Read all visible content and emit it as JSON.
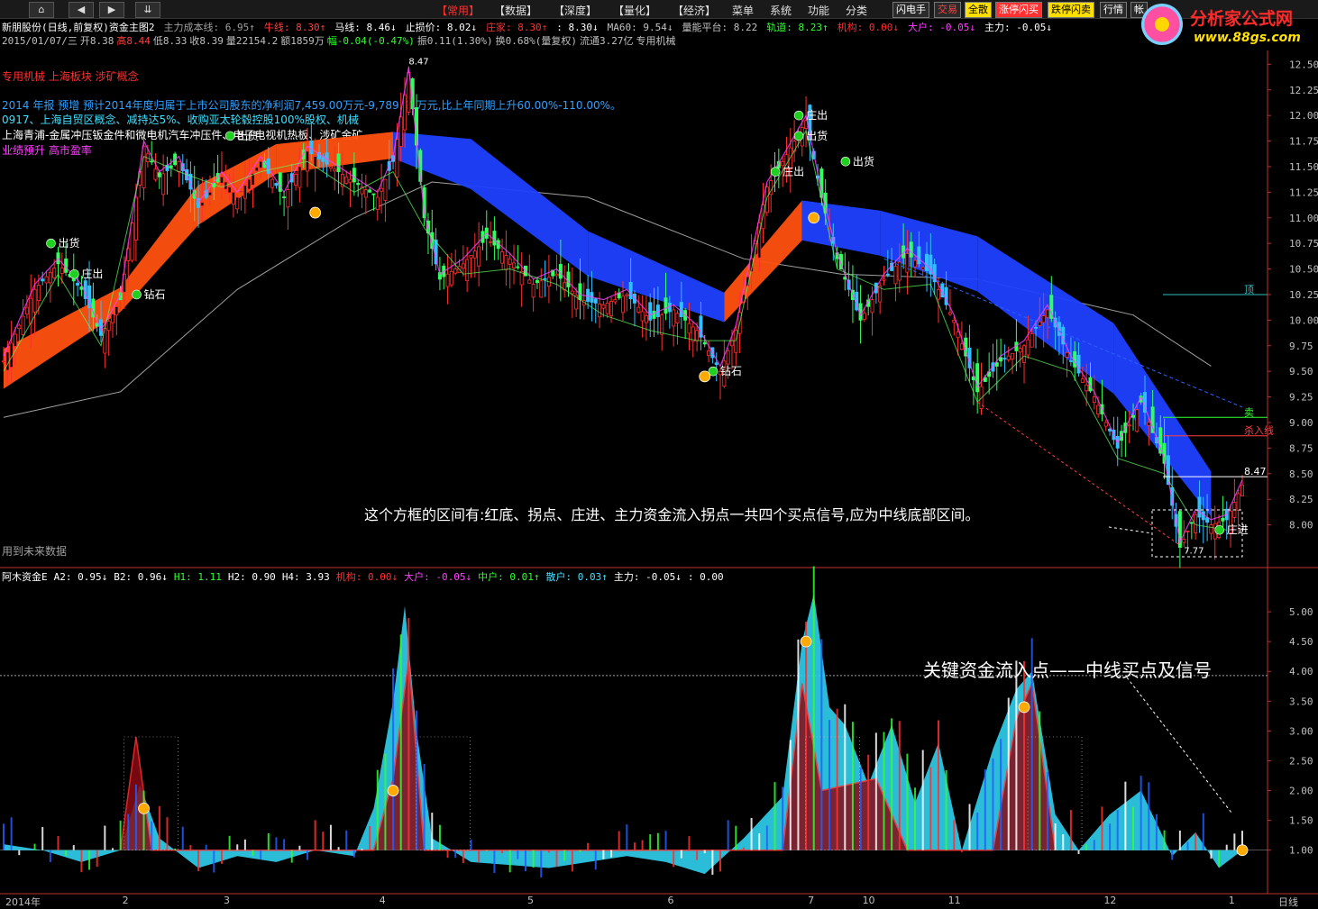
{
  "toolbar": {
    "nav": [
      "⌂",
      "◀",
      "▶",
      "⇊"
    ],
    "menus": [
      "【常用】",
      "【数据】",
      "【深度】",
      "【量化】",
      "【经济】",
      "菜单",
      "系统",
      "功能",
      "分类"
    ],
    "quick": [
      {
        "label": "闪电手",
        "bg": "#2a2a2a",
        "fg": "#ffffff"
      },
      {
        "label": "交易",
        "bg": "#2a2a2a",
        "fg": "#ff4040"
      },
      {
        "label": "全散",
        "bg": "#ffe000",
        "fg": "#000000"
      },
      {
        "label": "涨停闪买",
        "bg": "#ff3030",
        "fg": "#ffffff"
      },
      {
        "label": "跌停闪卖",
        "bg": "#ffe000",
        "fg": "#000000"
      },
      {
        "label": "行情",
        "bg": "#2a2a2a",
        "fg": "#ffffff"
      },
      {
        "label": "帐",
        "bg": "#2a2a2a",
        "fg": "#ffffff"
      }
    ]
  },
  "logo": {
    "title": "分析家公式网",
    "url": "www.88gs.com"
  },
  "header": {
    "line1": [
      {
        "text": "新朋股份(日线,前复权)资金主图2",
        "color": "#ffffff"
      },
      {
        "text": "主力成本线: 6.95↑",
        "color": "#a0a0a0"
      },
      {
        "text": "牛线: 8.30↑",
        "color": "#ff4040"
      },
      {
        "text": "马线: 8.46↓",
        "color": "#ffffff"
      },
      {
        "text": "止损价: 8.02↓",
        "color": "#ffffff"
      },
      {
        "text": "庄家: 8.30↑",
        "color": "#ff3030"
      },
      {
        "text": ": 8.30↓",
        "color": "#ffffff"
      },
      {
        "text": "MA60: 9.54↓",
        "color": "#c0c0c0"
      },
      {
        "text": "量能平台: 8.22",
        "color": "#c0c0c0"
      },
      {
        "text": "轨道: 8.23↑",
        "color": "#30ff30"
      },
      {
        "text": "机构: 0.00↓",
        "color": "#ff3030"
      },
      {
        "text": "大户: -0.05↓",
        "color": "#ff40ff"
      },
      {
        "text": "主力: -0.05↓",
        "color": "#ffffff"
      }
    ],
    "line2": [
      {
        "text": "2015/01/07/三",
        "color": "#c0c0c0"
      },
      {
        "text": "开8.38",
        "color": "#c0c0c0"
      },
      {
        "text": "高8.44",
        "color": "#ff4040"
      },
      {
        "text": "低8.33",
        "color": "#c0c0c0"
      },
      {
        "text": "收8.39",
        "color": "#c0c0c0"
      },
      {
        "text": "量22154.2",
        "color": "#c0c0c0"
      },
      {
        "text": "额1859万",
        "color": "#c0c0c0"
      },
      {
        "text": "幅-0.04(-0.47%)",
        "color": "#30ff30"
      },
      {
        "text": "振0.11(1.30%)",
        "color": "#c0c0c0"
      },
      {
        "text": "换0.68%(量复权)",
        "color": "#c0c0c0"
      },
      {
        "text": "流通3.27亿",
        "color": "#c0c0c0"
      },
      {
        "text": "专用机械",
        "color": "#c0c0c0"
      }
    ]
  },
  "info_lines": [
    {
      "text": "专用机械  上海板块  涉矿概念",
      "color": "#ff3030"
    },
    {
      "text": "2014 年报 预增 预计2014年度归属于上市公司股东的净利润7,459.00万元-9,789.91万元,比上年同期上升60.00%-110.00%。",
      "color": "#30a0ff"
    },
    {
      "text": "0917、上海自贸区概念、减持达5%、收购亚太轮毂控股100%股权、机械",
      "color": "#40e0ff"
    },
    {
      "text": "上海青浦-金属冲压钣金件和微电机汽车冲压件、电子电视机热板、涉矿金矿",
      "color": "#ffffff"
    },
    {
      "text": "业绩预升 高市盈率",
      "color": "#ff40ff"
    }
  ],
  "annotations": {
    "main_note": "这个方框的区间有:红底、拐点、庄进、主力资金流入拐点一共四个买点信号,应为中线底部区间。",
    "sub_note": "关键资金流入点——中线买点及信号",
    "future_data": "用到未来数据"
  },
  "signal_labels": [
    {
      "text": "出货",
      "color": "#ffffff"
    },
    {
      "text": "庄出",
      "color": "#ffffff"
    },
    {
      "text": "钻石",
      "color": "#ffffff"
    },
    {
      "text": "出货",
      "color": "#ffffff"
    },
    {
      "text": "庄出",
      "color": "#ffffff"
    },
    {
      "text": "出货",
      "color": "#ffffff"
    },
    {
      "text": "钻石",
      "color": "#ffffff"
    },
    {
      "text": "庄出",
      "color": "#ffffff"
    },
    {
      "text": "出货",
      "color": "#ffffff"
    },
    {
      "text": "庄进",
      "color": "#ffffff"
    },
    {
      "text": "顶",
      "color": "#30c0c0"
    },
    {
      "text": "卖",
      "color": "#30ff30"
    },
    {
      "text": "杀入线",
      "color": "#ff4040"
    },
    {
      "text": "8.47",
      "color": "#ffffff"
    },
    {
      "text": "7.77",
      "color": "#ffffff"
    }
  ],
  "sub_header": [
    {
      "text": "阿木资金E",
      "color": "#ffffff"
    },
    {
      "text": "A2: 0.95↓",
      "color": "#ffffff"
    },
    {
      "text": "B2: 0.96↓",
      "color": "#ffffff"
    },
    {
      "text": "H1: 1.11",
      "color": "#30ff30"
    },
    {
      "text": "H2: 0.90",
      "color": "#ffffff"
    },
    {
      "text": "H4: 3.93",
      "color": "#ffffff"
    },
    {
      "text": "机构: 0.00↓",
      "color": "#ff3030"
    },
    {
      "text": "大户: -0.05↓",
      "color": "#ff40ff"
    },
    {
      "text": "中户: 0.01↑",
      "color": "#30ff30"
    },
    {
      "text": "散户: 0.03↑",
      "color": "#40e0ff"
    },
    {
      "text": "主力: -0.05↓",
      "color": "#ffffff"
    },
    {
      "text": ": 0.00",
      "color": "#ffffff"
    }
  ],
  "time_axis": {
    "labels": [
      "2014年",
      "2",
      "3",
      "4",
      "5",
      "6",
      "7",
      "10",
      "11",
      "12",
      "1"
    ],
    "period": "日线"
  },
  "colors": {
    "up": "#ff3030",
    "down": "#30c0ff",
    "axis": "#c03030",
    "band_up": "#ff5010",
    "band_down": "#1e40ff",
    "ma60": "#a0a0a0"
  },
  "chart_data": [
    {
      "type": "candlestick",
      "title": "新朋股份(日线,前复权)资金主图2",
      "ylim": [
        7.6,
        12.6
      ],
      "y_ticks": [
        8.0,
        8.25,
        8.5,
        8.75,
        9.0,
        9.25,
        9.5,
        9.75,
        10.0,
        10.25,
        10.5,
        10.75,
        11.0,
        11.25,
        11.5,
        11.75,
        12.0,
        12.25,
        12.5
      ],
      "close_path": [
        [
          0,
          9.6
        ],
        [
          8,
          10.3
        ],
        [
          14,
          10.55
        ],
        [
          20,
          10.3
        ],
        [
          25,
          9.85
        ],
        [
          30,
          10.2
        ],
        [
          36,
          11.7
        ],
        [
          40,
          11.4
        ],
        [
          45,
          11.55
        ],
        [
          50,
          11.1
        ],
        [
          56,
          11.4
        ],
        [
          60,
          11.2
        ],
        [
          66,
          11.55
        ],
        [
          72,
          11.2
        ],
        [
          78,
          11.65
        ],
        [
          84,
          11.5
        ],
        [
          90,
          11.35
        ],
        [
          96,
          11.2
        ],
        [
          100,
          11.55
        ],
        [
          104,
          12.42
        ],
        [
          108,
          11.0
        ],
        [
          112,
          10.4
        ],
        [
          118,
          10.55
        ],
        [
          124,
          10.8
        ],
        [
          130,
          10.6
        ],
        [
          136,
          10.35
        ],
        [
          142,
          10.45
        ],
        [
          148,
          10.2
        ],
        [
          154,
          10.15
        ],
        [
          160,
          10.25
        ],
        [
          166,
          10.0
        ],
        [
          172,
          10.1
        ],
        [
          178,
          9.9
        ],
        [
          184,
          9.5
        ],
        [
          188,
          9.9
        ],
        [
          192,
          10.6
        ],
        [
          196,
          11.3
        ],
        [
          200,
          11.55
        ],
        [
          206,
          11.95
        ],
        [
          210,
          11.2
        ],
        [
          214,
          10.6
        ],
        [
          220,
          10.0
        ],
        [
          226,
          10.4
        ],
        [
          232,
          10.65
        ],
        [
          238,
          10.45
        ],
        [
          244,
          10.0
        ],
        [
          250,
          9.3
        ],
        [
          256,
          9.6
        ],
        [
          262,
          9.75
        ],
        [
          268,
          10.1
        ],
        [
          274,
          9.6
        ],
        [
          280,
          9.25
        ],
        [
          286,
          8.75
        ],
        [
          292,
          9.2
        ],
        [
          298,
          8.6
        ],
        [
          302,
          7.78
        ],
        [
          306,
          8.1
        ],
        [
          310,
          8.0
        ],
        [
          314,
          8.05
        ],
        [
          318,
          8.39
        ]
      ],
      "ma60_path": [
        [
          0,
          9.05
        ],
        [
          30,
          9.3
        ],
        [
          60,
          10.3
        ],
        [
          90,
          11.0
        ],
        [
          110,
          11.35
        ],
        [
          150,
          11.2
        ],
        [
          190,
          10.6
        ],
        [
          215,
          10.45
        ],
        [
          250,
          10.4
        ],
        [
          290,
          10.05
        ],
        [
          310,
          9.55
        ]
      ],
      "band_path": [
        [
          0,
          9.45,
          9.6
        ],
        [
          30,
          10.2,
          10.2
        ],
        [
          50,
          11.05,
          11.2
        ],
        [
          70,
          11.55,
          11.6
        ],
        [
          100,
          11.7,
          11.72
        ],
        [
          120,
          11.4,
          11.65
        ],
        [
          150,
          10.55,
          10.75
        ],
        [
          185,
          10.1,
          10.15
        ],
        [
          205,
          10.9,
          11.05
        ],
        [
          225,
          10.75,
          10.95
        ],
        [
          250,
          10.4,
          10.7
        ],
        [
          285,
          9.4,
          9.85
        ],
        [
          310,
          8.2,
          8.4
        ]
      ],
      "key_levels": [
        {
          "label": "顶",
          "value": 10.25
        },
        {
          "label": "卖",
          "value": 9.05
        },
        {
          "label": "杀入线",
          "value": 8.87
        },
        {
          "label": "8.47",
          "value": 8.47
        }
      ]
    },
    {
      "type": "area",
      "title": "阿木资金E",
      "ylim": [
        0.3,
        5.5
      ],
      "y_ticks": [
        1.0,
        1.5,
        2.0,
        2.5,
        3.0,
        3.5,
        4.0,
        4.5,
        5.0
      ],
      "reference": 3.93,
      "series": [
        {
          "name": "散户",
          "values": [
            [
              0,
              1.1
            ],
            [
              10,
              1.0
            ],
            [
              20,
              0.8
            ],
            [
              30,
              1.0
            ],
            [
              35,
              2.1
            ],
            [
              40,
              1.2
            ],
            [
              50,
              0.7
            ],
            [
              60,
              0.9
            ],
            [
              70,
              0.8
            ],
            [
              80,
              1.0
            ],
            [
              90,
              0.9
            ],
            [
              95,
              1.7
            ],
            [
              100,
              3.5
            ],
            [
              103,
              5.1
            ],
            [
              106,
              3.0
            ],
            [
              110,
              1.2
            ],
            [
              120,
              0.8
            ],
            [
              140,
              0.7
            ],
            [
              160,
              0.9
            ],
            [
              170,
              0.8
            ],
            [
              180,
              0.6
            ],
            [
              190,
              1.2
            ],
            [
              200,
              1.9
            ],
            [
              205,
              4.5
            ],
            [
              208,
              5.3
            ],
            [
              212,
              3.4
            ],
            [
              216,
              3.1
            ],
            [
              222,
              2.1
            ],
            [
              228,
              3.1
            ],
            [
              234,
              1.8
            ],
            [
              240,
              2.8
            ],
            [
              246,
              1.0
            ],
            [
              254,
              2.7
            ],
            [
              260,
              3.7
            ],
            [
              264,
              4.0
            ],
            [
              270,
              1.6
            ],
            [
              276,
              1.0
            ],
            [
              284,
              1.6
            ],
            [
              292,
              2.0
            ],
            [
              300,
              0.9
            ],
            [
              306,
              1.3
            ],
            [
              312,
              0.7
            ],
            [
              318,
              1.0
            ]
          ]
        },
        {
          "name": "机构",
          "values": [
            [
              30,
              1.0
            ],
            [
              34,
              2.9
            ],
            [
              38,
              1.0
            ],
            [
              95,
              1.0
            ],
            [
              100,
              2.2
            ],
            [
              104,
              4.2
            ],
            [
              108,
              1.0
            ],
            [
              200,
              1.0
            ],
            [
              205,
              3.8
            ],
            [
              210,
              2.0
            ],
            [
              224,
              2.2
            ],
            [
              232,
              1.0
            ],
            [
              254,
              1.0
            ],
            [
              260,
              3.2
            ],
            [
              264,
              3.8
            ],
            [
              270,
              1.0
            ]
          ]
        }
      ]
    }
  ]
}
